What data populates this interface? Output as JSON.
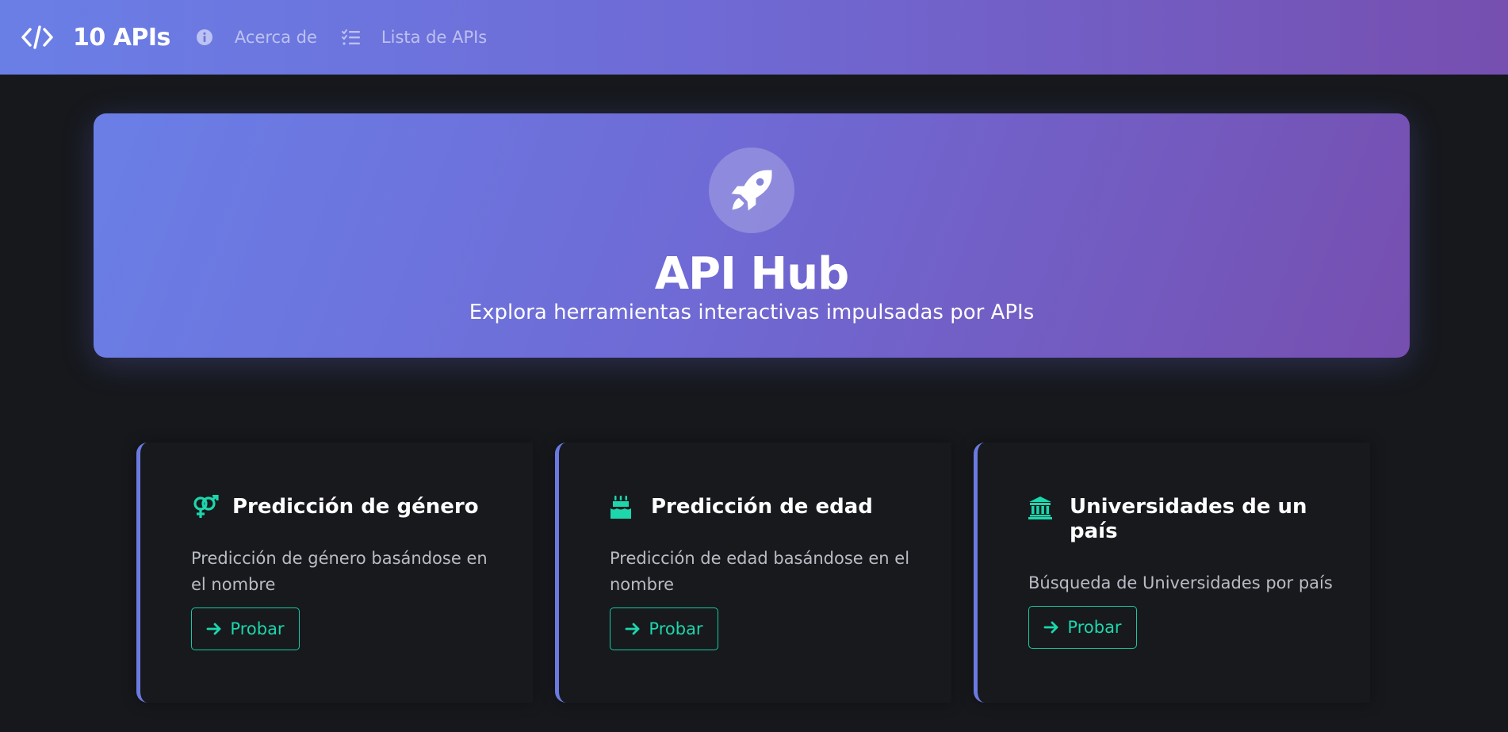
{
  "navbar": {
    "brand_icon": "code-icon",
    "brand": "10 APIs",
    "links": [
      {
        "icon": "info-circle-icon",
        "label": "Acerca de"
      },
      {
        "icon": "list-check-icon",
        "label": "Lista de APIs"
      }
    ]
  },
  "hero": {
    "icon": "rocket-icon",
    "title": "API Hub",
    "subtitle": "Explora herramientas interactivas impulsadas por APIs"
  },
  "cards": [
    {
      "icon": "venus-mars-icon",
      "title": "Predicción de género",
      "description": "Predicción de género basándose en el nombre",
      "button": "Probar"
    },
    {
      "icon": "birthday-cake-icon",
      "title": "Predicción de edad",
      "description": "Predicción de edad basándose en el nombre",
      "button": "Probar"
    },
    {
      "icon": "university-icon",
      "title": "Universidades de un país",
      "description": "Búsqueda de Universidades por país",
      "button": "Probar"
    }
  ],
  "colors": {
    "gradient_start": "#6a7fe6",
    "gradient_end": "#764fb0",
    "accent": "#6b7ae0",
    "button": "#1dd6ac",
    "background": "#16181c"
  }
}
